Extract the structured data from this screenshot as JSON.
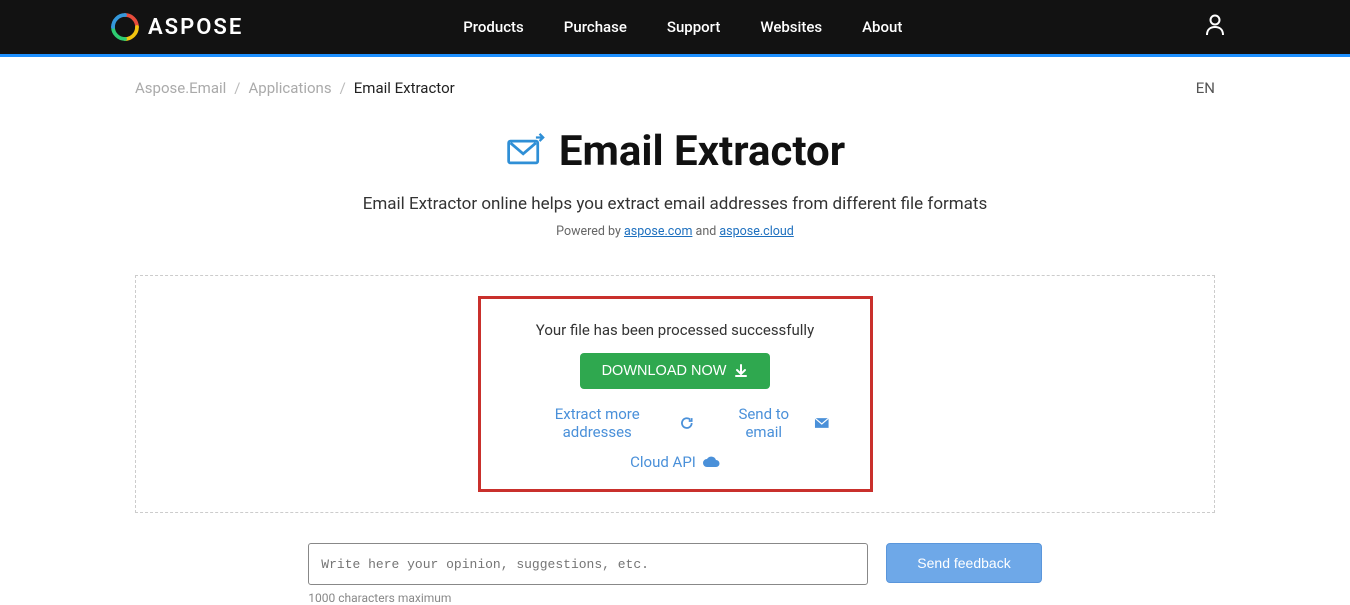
{
  "header": {
    "brand": "ASPOSE",
    "nav": [
      "Products",
      "Purchase",
      "Support",
      "Websites",
      "About"
    ]
  },
  "breadcrumb": {
    "items": [
      "Aspose.Email",
      "Applications"
    ],
    "current": "Email Extractor",
    "lang": "EN"
  },
  "page": {
    "title": "Email Extractor",
    "subtitle": "Email Extractor online helps you extract email addresses from different file formats",
    "powered_prefix": "Powered by ",
    "powered_link1": "aspose.com",
    "powered_and": " and ",
    "powered_link2": "aspose.cloud"
  },
  "result": {
    "message": "Your file has been processed successfully",
    "download_label": "DOWNLOAD NOW",
    "extract_more": "Extract more addresses",
    "send_email": "Send to email",
    "cloud_api": "Cloud API"
  },
  "feedback": {
    "placeholder": "Write here your opinion, suggestions, etc.",
    "hint": "1000 characters maximum",
    "button": "Send feedback"
  },
  "colors": {
    "accent_blue": "#1e90ff",
    "link_blue": "#4a90d9",
    "download_green": "#2fa84f",
    "highlight_red": "#c9302c",
    "feedback_blue": "#6ea8e8"
  }
}
